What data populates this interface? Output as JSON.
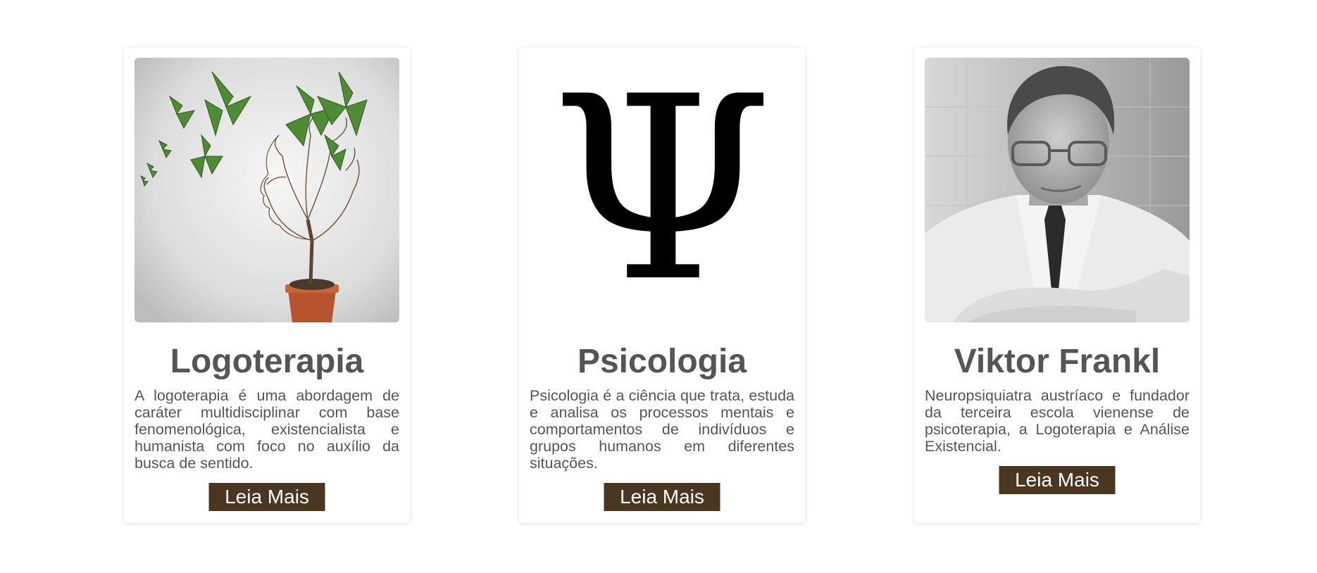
{
  "cards": [
    {
      "title": "Logoterapia",
      "text": "A logoterapia é uma abordagem de caráter multidisciplinar com base fenomenológica, existencialista e humanista com foco no auxílio da busca de sentido.",
      "button_label": "Leia Mais",
      "image": "tree-head-butterflies-illustration"
    },
    {
      "title": "Psicologia",
      "text": "Psicologia é a ciência que trata, estuda e analisa os processos mentais e comportamentos de indivíduos e grupos humanos em diferentes situações.",
      "button_label": "Leia Mais",
      "image": "psi-symbol",
      "glyph": "Ψ"
    },
    {
      "title": "Viktor Frankl",
      "text": "Neuropsiquiatra austríaco e fundador da terceira escola vienense de psicoterapia, a Logoterapia e Análise Existencial.",
      "button_label": "Leia Mais",
      "image": "viktor-frankl-portrait-photo"
    }
  ],
  "colors": {
    "button_background": "#4a3621",
    "button_text": "#ffffff",
    "heading_text": "#555555",
    "body_text": "#555555"
  }
}
